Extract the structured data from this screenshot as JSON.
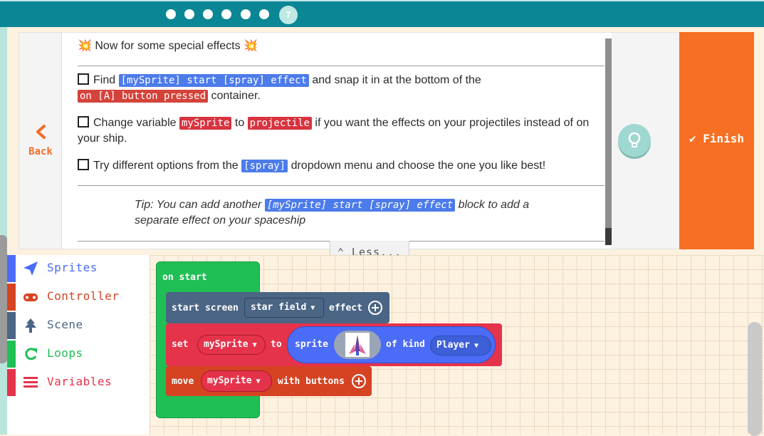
{
  "stepper": {
    "current_step": "7",
    "completed_dots": 6
  },
  "tutorial": {
    "title_icon": "💥",
    "title": "Now for some special effects",
    "step1": {
      "text1": "Find",
      "block": "[mySprite] start [spray] effect",
      "text2": "and snap it in at the bottom of the",
      "block2": "on [A] button pressed",
      "text3": "container."
    },
    "step2": {
      "text1": "Change variable",
      "block1": "mySprite",
      "text2": "to",
      "block2": "projectile",
      "text3": "if you want the effects on your projectiles instead of on",
      "text4": "your ship."
    },
    "step3": {
      "text1": "Try different options from the",
      "block": "[spray]",
      "text2": "dropdown menu and choose the one you like best!"
    },
    "tip": {
      "text1": "Tip: You can add another",
      "block": "[mySprite] start [spray] effect",
      "text2": "block to add a",
      "text3": "separate effect on your spaceship"
    }
  },
  "nav": {
    "back_label": "Back",
    "finish_label": "Finish",
    "less_label": "Less..."
  },
  "toolbox": {
    "categories": [
      {
        "label": "Sprites",
        "color": "#4b6cf6"
      },
      {
        "label": "Controller",
        "color": "#d54322"
      },
      {
        "label": "Scene",
        "color": "#4b6584"
      },
      {
        "label": "Loops",
        "color": "#20bf55"
      },
      {
        "label": "Variables",
        "color": "#e5334b"
      }
    ]
  },
  "blocks": {
    "on_start": "on start",
    "start_screen": {
      "label": "start screen",
      "dropdown": "star field",
      "suffix": "effect"
    },
    "set": {
      "label": "set",
      "var": "mySprite",
      "to": "to",
      "sprite": "sprite",
      "of_kind": "of kind",
      "kind": "Player"
    },
    "move": {
      "label": "move",
      "var": "mySprite",
      "suffix": "with buttons"
    }
  },
  "colors": {
    "topbar": "#0b8694",
    "finish": "#f76f22",
    "back": "#ef6d27",
    "loops": "#20bf55",
    "scene": "#4b6584",
    "variables": "#e5334b",
    "sprites": "#4b6cf6",
    "controller": "#d54322"
  }
}
